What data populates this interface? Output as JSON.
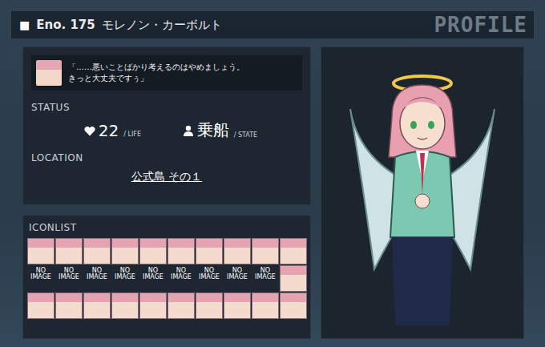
{
  "header": {
    "marker": "■",
    "eno": "Eno. 175",
    "name": "モレノン・カーボルト",
    "watermark": "PROFILE"
  },
  "speech": {
    "lines": [
      "「……悪いことばかり考えるのはやめましょう。",
      "きっと大丈夫ですぅ」"
    ]
  },
  "status": {
    "label": "STATUS",
    "life": {
      "value": "22",
      "unit": "/ LIFE"
    },
    "state": {
      "value": "乗船",
      "unit": "/ STATE"
    }
  },
  "location": {
    "label": "LOCATION",
    "place": "公式島 その１"
  },
  "iconlist": {
    "label": "ICONLIST",
    "icons": [
      {
        "kind": "image"
      },
      {
        "kind": "image"
      },
      {
        "kind": "image"
      },
      {
        "kind": "image"
      },
      {
        "kind": "image"
      },
      {
        "kind": "image"
      },
      {
        "kind": "image"
      },
      {
        "kind": "image"
      },
      {
        "kind": "image"
      },
      {
        "kind": "image"
      },
      {
        "kind": "missing",
        "text": "NO IMAGE"
      },
      {
        "kind": "missing",
        "text": "NO IMAGE"
      },
      {
        "kind": "missing",
        "text": "NO IMAGE"
      },
      {
        "kind": "missing",
        "text": "NO IMAGE"
      },
      {
        "kind": "missing",
        "text": "NO IMAGE"
      },
      {
        "kind": "missing",
        "text": "NO IMAGE"
      },
      {
        "kind": "missing",
        "text": "NO IMAGE"
      },
      {
        "kind": "missing",
        "text": "NO IMAGE"
      },
      {
        "kind": "missing",
        "text": "NO IMAGE"
      },
      {
        "kind": "image"
      },
      {
        "kind": "image"
      },
      {
        "kind": "image"
      },
      {
        "kind": "image"
      },
      {
        "kind": "image"
      },
      {
        "kind": "image"
      },
      {
        "kind": "image"
      },
      {
        "kind": "image"
      },
      {
        "kind": "image"
      },
      {
        "kind": "image"
      },
      {
        "kind": "image"
      }
    ]
  }
}
